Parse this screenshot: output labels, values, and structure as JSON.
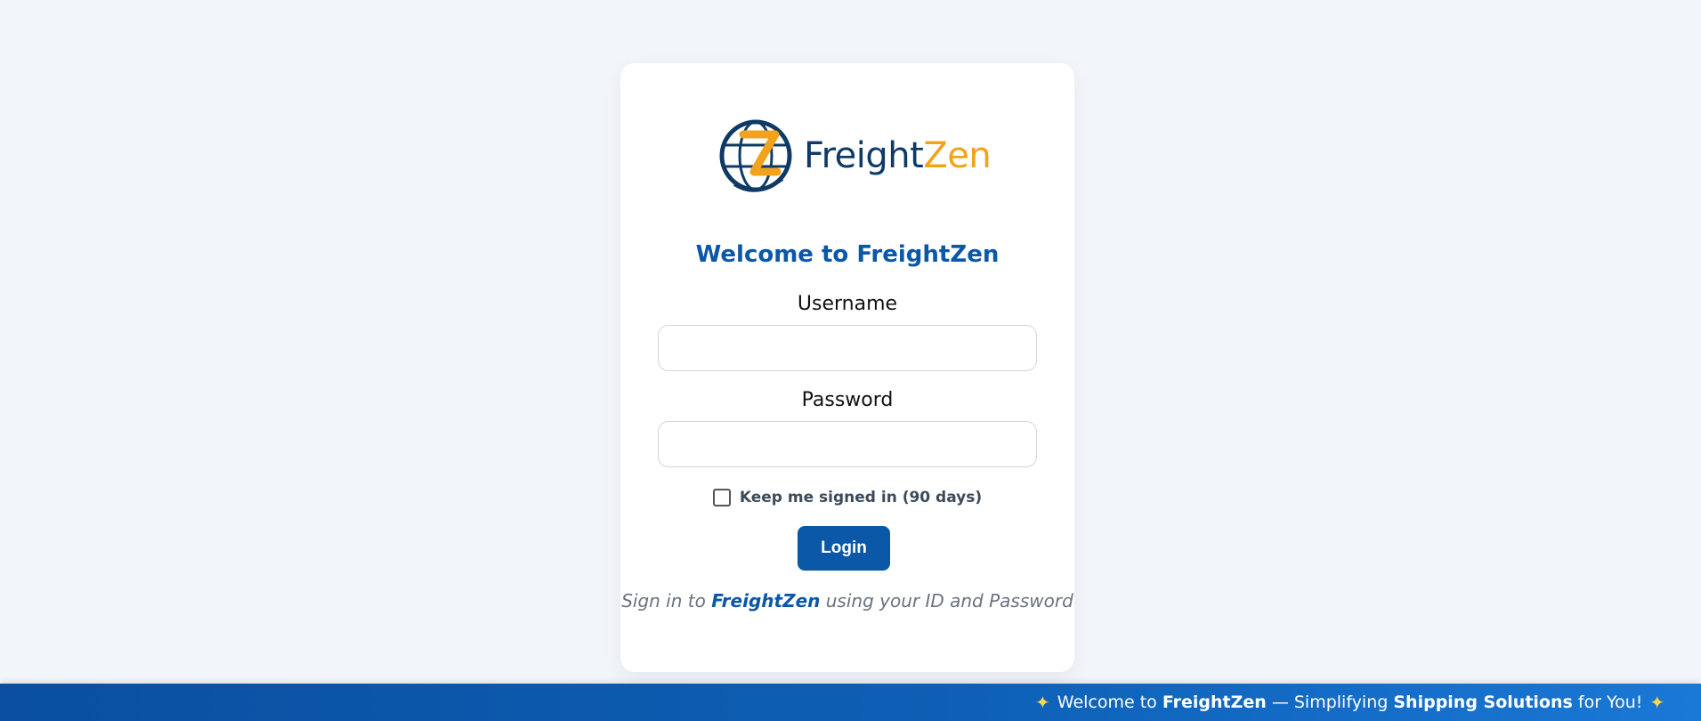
{
  "logo": {
    "part1": "Freight",
    "part2": "Zen",
    "icon": "globe-z-logo-icon"
  },
  "login": {
    "title": "Welcome to FreightZen",
    "username_label": "Username",
    "username_value": "",
    "username_placeholder": "",
    "password_label": "Password",
    "password_value": "",
    "password_placeholder": "",
    "remember_label": "Keep me signed in (90 days)",
    "remember_checked": false,
    "login_button": "Login",
    "helper_prefix": "Sign in to",
    "helper_brand": "FreightZen",
    "helper_suffix": "using your ID and Password"
  },
  "ticker": {
    "icon": "sparkles-icon",
    "part1": "Welcome to",
    "part2": "FreightZen",
    "part3": "— Simplifying",
    "part4": "Shipping Solutions",
    "part5": "for You!"
  },
  "colors": {
    "primary": "#0b57a8",
    "accent": "#f3a21c",
    "navy": "#0e3a66",
    "background": "#f2f5f9"
  }
}
